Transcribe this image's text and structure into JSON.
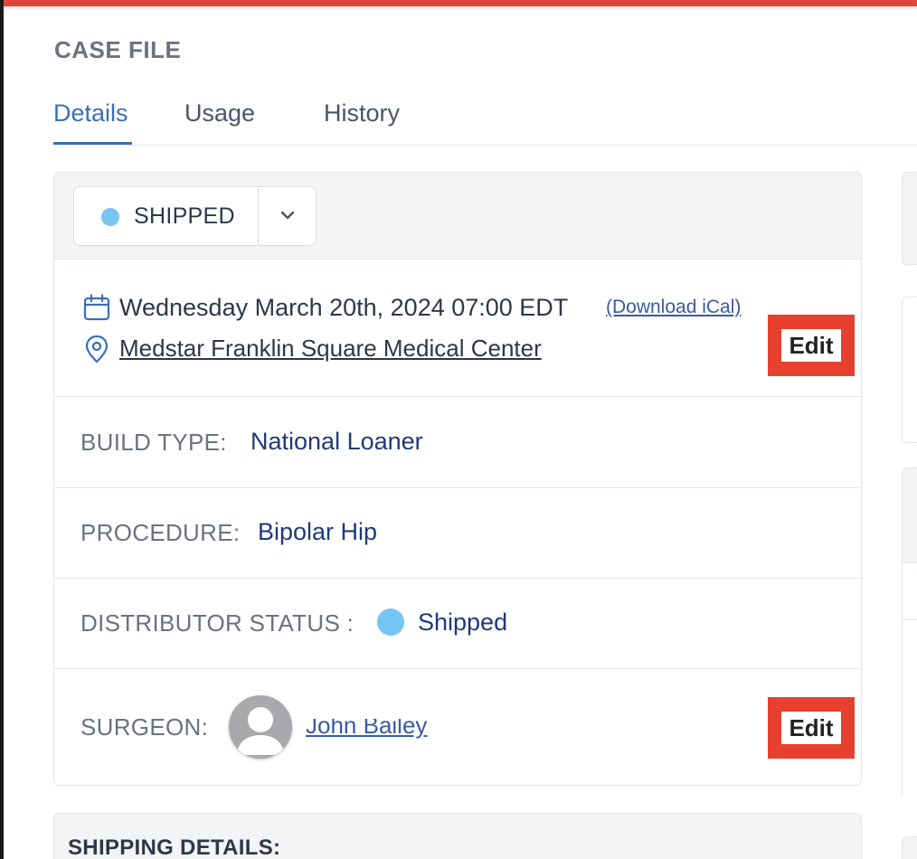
{
  "case": {
    "title": "CASE FILE"
  },
  "tabs": [
    {
      "label": "Details",
      "active": true
    },
    {
      "label": "Usage",
      "active": false
    },
    {
      "label": "History",
      "active": false
    }
  ],
  "status": {
    "label": "SHIPPED",
    "dot_color": "#74c6f2"
  },
  "schedule": {
    "datetime": "Wednesday March 20th, 2024 07:00 EDT",
    "ical_label": "(Download iCal)",
    "location": "Medstar Franklin Square Medical Center"
  },
  "edit_label": "Edit",
  "fields": {
    "build_type": {
      "label": "BUILD TYPE:",
      "value": "National Loaner"
    },
    "procedure": {
      "label": "PROCEDURE:",
      "value": "Bipolar Hip"
    },
    "distributor_status": {
      "label": "DISTRIBUTOR STATUS :",
      "value": "Shipped",
      "dot_color": "#74c6f2"
    },
    "surgeon": {
      "label": "SURGEON:",
      "name": "John Bailey"
    }
  },
  "shipping": {
    "title": "SHIPPING DETAILS:"
  },
  "colors": {
    "accent": "#3b6fb6",
    "highlight": "#e8402f",
    "top_bar": "#e0453a"
  }
}
